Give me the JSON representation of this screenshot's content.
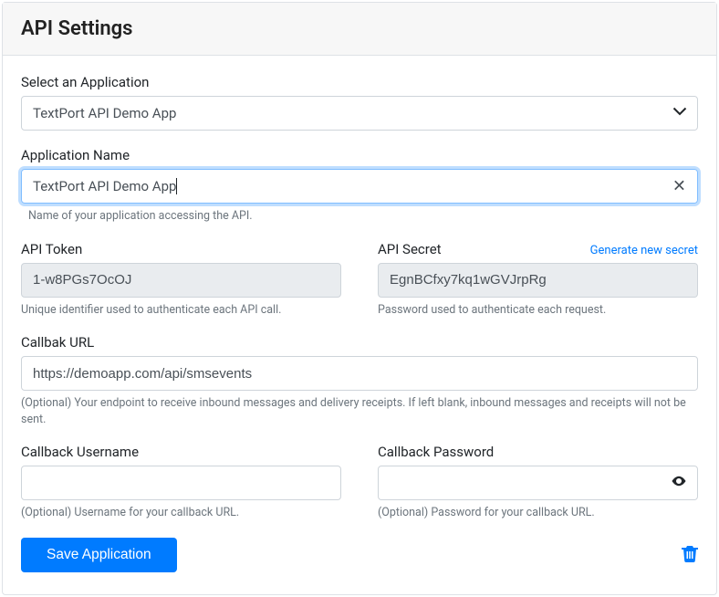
{
  "header": {
    "title": "API Settings"
  },
  "selectApp": {
    "label": "Select an Application",
    "value": "TextPort API Demo App"
  },
  "appName": {
    "label": "Application Name",
    "value": "TextPort API Demo App",
    "helper": "Name of your application accessing the API."
  },
  "apiToken": {
    "label": "API Token",
    "value": "1-w8PGs7OcOJ",
    "helper": "Unique identifier used to authenticate each API call."
  },
  "apiSecret": {
    "label": "API Secret",
    "link": "Generate new secret",
    "value": "EgnBCfxy7kq1wGVJrpRg",
    "helper": "Password used to authenticate each request."
  },
  "callbackUrl": {
    "label": "Callbak URL",
    "value": "https://demoapp.com/api/smsevents",
    "helper": "(Optional) Your endpoint to receive inbound messages and delivery receipts. If left blank, inbound messages and receipts will not be sent."
  },
  "callbackUser": {
    "label": "Callback Username",
    "value": "",
    "helper": "(Optional) Username for your callback URL."
  },
  "callbackPass": {
    "label": "Callback Password",
    "value": "",
    "helper": "(Optional) Password for your callback URL."
  },
  "actions": {
    "save": "Save Application"
  }
}
